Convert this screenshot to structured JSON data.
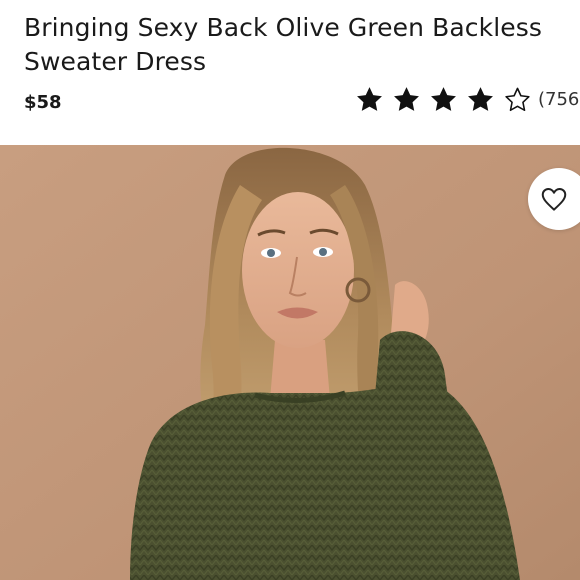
{
  "product": {
    "title_line1": "Bringing Sexy Back Olive Green Backless",
    "title_line2": "Sweater Dress",
    "price": "$58",
    "rating": 4,
    "rating_max": 5,
    "review_count": "(756)"
  },
  "image": {
    "description": "Model wearing olive green knit sweater dress"
  },
  "icons": {
    "star_filled": "star-filled-icon",
    "star_empty": "star-outline-icon",
    "favorite": "heart-outline-icon"
  },
  "colors": {
    "text": "#1a1a1a",
    "star": "#111111",
    "background_photo": "#c49a7c",
    "sweater": "#4a4f30"
  }
}
